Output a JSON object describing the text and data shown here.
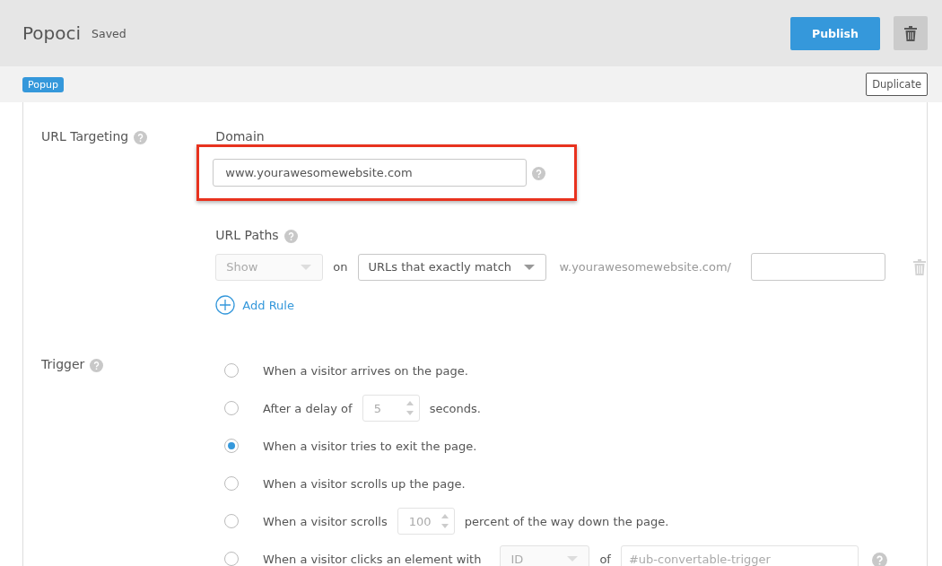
{
  "header": {
    "title": "Popoci",
    "status": "Saved",
    "publish_button": "Publish"
  },
  "subbar": {
    "type_badge": "Popup",
    "duplicate_button": "Duplicate"
  },
  "url_targeting": {
    "label": "URL Targeting",
    "domain_label": "Domain",
    "domain_value": "www.yourawesomewebsite.com",
    "highlighted": true,
    "paths_label": "URL Paths",
    "rule": {
      "action": "Show",
      "connector": "on",
      "match": "URLs that exactly match",
      "prefix": "w.yourawesomewebsite.com/"
    },
    "add_rule": "Add Rule"
  },
  "trigger": {
    "label": "Trigger",
    "options": [
      {
        "selected": false,
        "parts": [
          {
            "kind": "text",
            "text": "When a visitor arrives on the page."
          }
        ]
      },
      {
        "selected": false,
        "parts": [
          {
            "kind": "text",
            "text": "After a delay of"
          },
          {
            "kind": "number",
            "text": "5"
          },
          {
            "kind": "text",
            "text": "seconds."
          }
        ]
      },
      {
        "selected": true,
        "parts": [
          {
            "kind": "text",
            "text": "When a visitor tries to exit the page."
          }
        ]
      },
      {
        "selected": false,
        "parts": [
          {
            "kind": "text",
            "text": "When a visitor scrolls up the page."
          }
        ]
      },
      {
        "selected": false,
        "parts": [
          {
            "kind": "text",
            "text": "When a visitor scrolls"
          },
          {
            "kind": "number",
            "text": "100"
          },
          {
            "kind": "text",
            "text": "percent of the way down the page."
          }
        ]
      },
      {
        "selected": false,
        "parts": [
          {
            "kind": "text",
            "text": "When a visitor clicks an element with"
          },
          {
            "kind": "select",
            "text": "ID"
          },
          {
            "kind": "text",
            "text": "of"
          },
          {
            "kind": "field",
            "text": "#ub-convertable-trigger"
          },
          {
            "kind": "help"
          }
        ]
      }
    ]
  }
}
